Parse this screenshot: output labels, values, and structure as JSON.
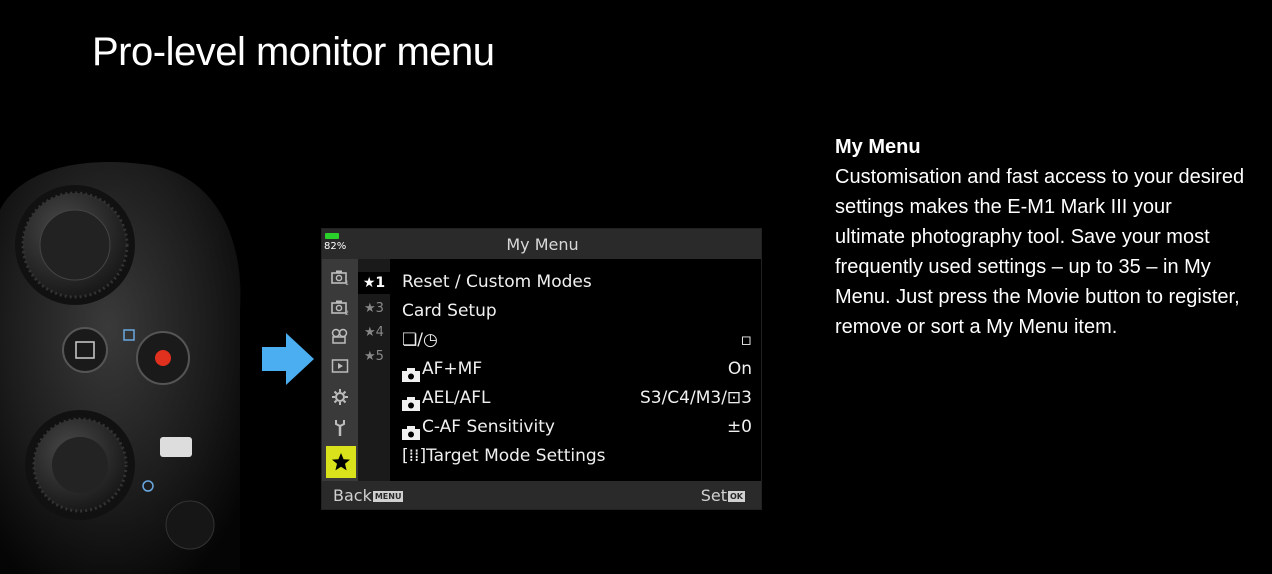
{
  "page": {
    "title": "Pro-level monitor menu"
  },
  "monitor": {
    "battery": "82%",
    "title": "My Menu",
    "side_tabs": [
      {
        "icon": "camera-1-icon"
      },
      {
        "icon": "camera-2-icon"
      },
      {
        "icon": "video-icon"
      },
      {
        "icon": "playback-icon"
      },
      {
        "icon": "custom-settings-icon"
      },
      {
        "icon": "setup-wrench-icon"
      },
      {
        "icon": "star-icon",
        "active": true
      }
    ],
    "page_tabs": [
      "★1",
      "★3",
      "★4",
      "★5"
    ],
    "items": [
      {
        "label": "Reset / Custom Modes",
        "value": ""
      },
      {
        "label": "Card Setup",
        "value": ""
      },
      {
        "label": "❏/◷",
        "value": "▫"
      },
      {
        "label": "AF+MF",
        "value": "On"
      },
      {
        "label": "AEL/AFL",
        "value": "S3/C4/M3/⊡3"
      },
      {
        "label": "C-AF Sensitivity",
        "value": "±0"
      },
      {
        "label": "[⁞⁞]Target Mode Settings",
        "value": ""
      }
    ],
    "footer": {
      "back": "Back",
      "back_tag": "MENU",
      "set": "Set",
      "set_tag": "OK"
    }
  },
  "description": {
    "title": "My Menu",
    "body": "Customisation and fast access to your desired settings makes the E-M1 Mark III your ultimate photography tool. Save your most frequently used settings – up to 35 – in My Menu. Just press the Movie button to register, remove or sort a My Menu item."
  },
  "colors": {
    "accent": "#d9e21a",
    "arrow": "#4aaef0",
    "battery": "#2ad12a"
  }
}
